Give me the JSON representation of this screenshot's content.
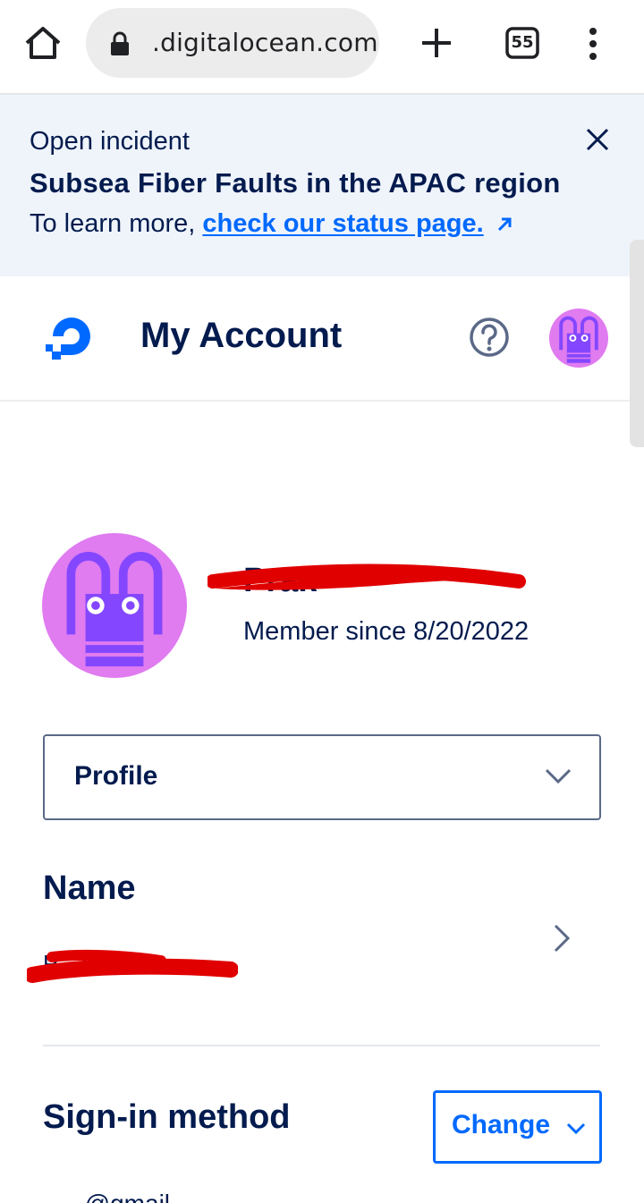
{
  "browser": {
    "url": ".digitalocean.com",
    "tab_count": "55"
  },
  "banner": {
    "kicker": "Open incident",
    "title": "Subsea Fiber Faults in the APAC region",
    "body_prefix": "To learn more,",
    "link_text": "check our status page."
  },
  "header": {
    "title": "My Account"
  },
  "profile": {
    "name_partial": "Prak",
    "member_since": "Member since 8/20/2022",
    "section_select": "Profile"
  },
  "name_section": {
    "heading": "Name",
    "value_partial": "P... P..."
  },
  "signin": {
    "heading": "Sign-in method",
    "change_label": "Change",
    "email_partial": "......@gmail..."
  },
  "colors": {
    "navy": "#031b4e",
    "brand_blue": "#0069ff",
    "banner_bg": "#eff4fb",
    "avatar_pink": "#e07bf0",
    "avatar_purple": "#8447ff",
    "redaction_red": "#e00000"
  }
}
